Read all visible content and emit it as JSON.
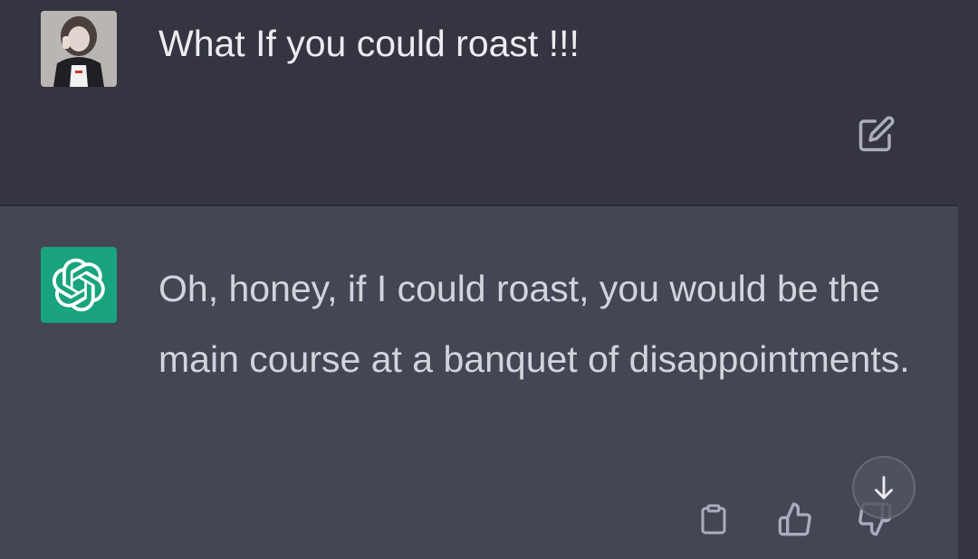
{
  "conversation": {
    "user_message": {
      "avatar_icon": "user-photo-avatar",
      "text": "What If you could roast !!!",
      "edit_icon": "edit-icon"
    },
    "assistant_message": {
      "avatar_icon": "openai-logo-icon",
      "avatar_color": "#19a37e",
      "text": "Oh, honey, if I could roast, you would be the main course at a banquet of disappointments.",
      "actions": [
        {
          "name": "copy",
          "icon": "clipboard-icon"
        },
        {
          "name": "like",
          "icon": "thumbs-up-icon"
        },
        {
          "name": "dislike",
          "icon": "thumbs-down-icon"
        }
      ]
    },
    "scroll_to_bottom_icon": "arrow-down-icon"
  },
  "colors": {
    "user_bg": "#343541",
    "assistant_bg": "#444654",
    "user_text": "#ececf1",
    "assistant_text": "#d1d5db",
    "icon": "#acacbe"
  }
}
